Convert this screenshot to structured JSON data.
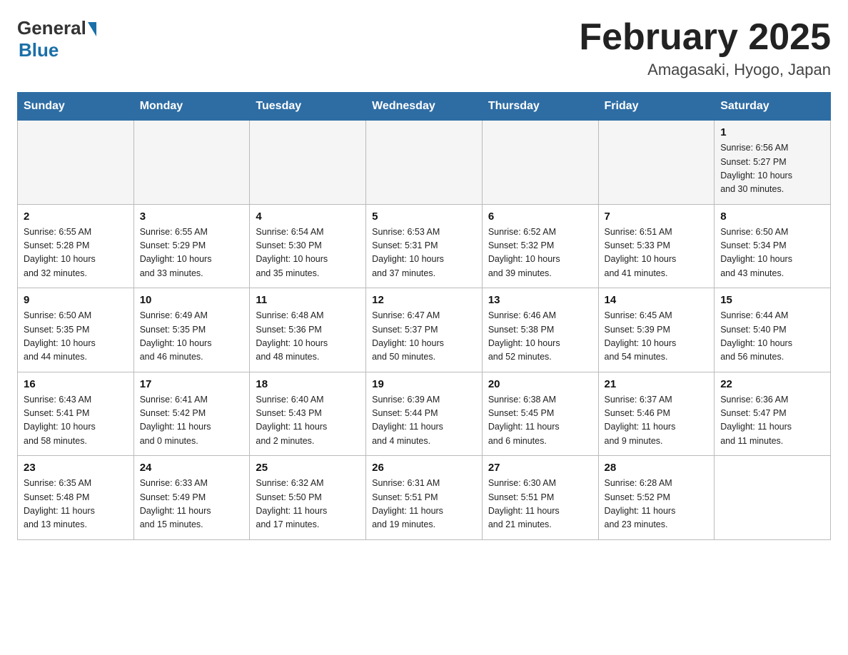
{
  "header": {
    "logo_general": "General",
    "logo_blue": "Blue",
    "month_title": "February 2025",
    "location": "Amagasaki, Hyogo, Japan"
  },
  "weekdays": [
    "Sunday",
    "Monday",
    "Tuesday",
    "Wednesday",
    "Thursday",
    "Friday",
    "Saturday"
  ],
  "weeks": [
    [
      {
        "day": "",
        "info": ""
      },
      {
        "day": "",
        "info": ""
      },
      {
        "day": "",
        "info": ""
      },
      {
        "day": "",
        "info": ""
      },
      {
        "day": "",
        "info": ""
      },
      {
        "day": "",
        "info": ""
      },
      {
        "day": "1",
        "info": "Sunrise: 6:56 AM\nSunset: 5:27 PM\nDaylight: 10 hours\nand 30 minutes."
      }
    ],
    [
      {
        "day": "2",
        "info": "Sunrise: 6:55 AM\nSunset: 5:28 PM\nDaylight: 10 hours\nand 32 minutes."
      },
      {
        "day": "3",
        "info": "Sunrise: 6:55 AM\nSunset: 5:29 PM\nDaylight: 10 hours\nand 33 minutes."
      },
      {
        "day": "4",
        "info": "Sunrise: 6:54 AM\nSunset: 5:30 PM\nDaylight: 10 hours\nand 35 minutes."
      },
      {
        "day": "5",
        "info": "Sunrise: 6:53 AM\nSunset: 5:31 PM\nDaylight: 10 hours\nand 37 minutes."
      },
      {
        "day": "6",
        "info": "Sunrise: 6:52 AM\nSunset: 5:32 PM\nDaylight: 10 hours\nand 39 minutes."
      },
      {
        "day": "7",
        "info": "Sunrise: 6:51 AM\nSunset: 5:33 PM\nDaylight: 10 hours\nand 41 minutes."
      },
      {
        "day": "8",
        "info": "Sunrise: 6:50 AM\nSunset: 5:34 PM\nDaylight: 10 hours\nand 43 minutes."
      }
    ],
    [
      {
        "day": "9",
        "info": "Sunrise: 6:50 AM\nSunset: 5:35 PM\nDaylight: 10 hours\nand 44 minutes."
      },
      {
        "day": "10",
        "info": "Sunrise: 6:49 AM\nSunset: 5:35 PM\nDaylight: 10 hours\nand 46 minutes."
      },
      {
        "day": "11",
        "info": "Sunrise: 6:48 AM\nSunset: 5:36 PM\nDaylight: 10 hours\nand 48 minutes."
      },
      {
        "day": "12",
        "info": "Sunrise: 6:47 AM\nSunset: 5:37 PM\nDaylight: 10 hours\nand 50 minutes."
      },
      {
        "day": "13",
        "info": "Sunrise: 6:46 AM\nSunset: 5:38 PM\nDaylight: 10 hours\nand 52 minutes."
      },
      {
        "day": "14",
        "info": "Sunrise: 6:45 AM\nSunset: 5:39 PM\nDaylight: 10 hours\nand 54 minutes."
      },
      {
        "day": "15",
        "info": "Sunrise: 6:44 AM\nSunset: 5:40 PM\nDaylight: 10 hours\nand 56 minutes."
      }
    ],
    [
      {
        "day": "16",
        "info": "Sunrise: 6:43 AM\nSunset: 5:41 PM\nDaylight: 10 hours\nand 58 minutes."
      },
      {
        "day": "17",
        "info": "Sunrise: 6:41 AM\nSunset: 5:42 PM\nDaylight: 11 hours\nand 0 minutes."
      },
      {
        "day": "18",
        "info": "Sunrise: 6:40 AM\nSunset: 5:43 PM\nDaylight: 11 hours\nand 2 minutes."
      },
      {
        "day": "19",
        "info": "Sunrise: 6:39 AM\nSunset: 5:44 PM\nDaylight: 11 hours\nand 4 minutes."
      },
      {
        "day": "20",
        "info": "Sunrise: 6:38 AM\nSunset: 5:45 PM\nDaylight: 11 hours\nand 6 minutes."
      },
      {
        "day": "21",
        "info": "Sunrise: 6:37 AM\nSunset: 5:46 PM\nDaylight: 11 hours\nand 9 minutes."
      },
      {
        "day": "22",
        "info": "Sunrise: 6:36 AM\nSunset: 5:47 PM\nDaylight: 11 hours\nand 11 minutes."
      }
    ],
    [
      {
        "day": "23",
        "info": "Sunrise: 6:35 AM\nSunset: 5:48 PM\nDaylight: 11 hours\nand 13 minutes."
      },
      {
        "day": "24",
        "info": "Sunrise: 6:33 AM\nSunset: 5:49 PM\nDaylight: 11 hours\nand 15 minutes."
      },
      {
        "day": "25",
        "info": "Sunrise: 6:32 AM\nSunset: 5:50 PM\nDaylight: 11 hours\nand 17 minutes."
      },
      {
        "day": "26",
        "info": "Sunrise: 6:31 AM\nSunset: 5:51 PM\nDaylight: 11 hours\nand 19 minutes."
      },
      {
        "day": "27",
        "info": "Sunrise: 6:30 AM\nSunset: 5:51 PM\nDaylight: 11 hours\nand 21 minutes."
      },
      {
        "day": "28",
        "info": "Sunrise: 6:28 AM\nSunset: 5:52 PM\nDaylight: 11 hours\nand 23 minutes."
      },
      {
        "day": "",
        "info": ""
      }
    ]
  ]
}
